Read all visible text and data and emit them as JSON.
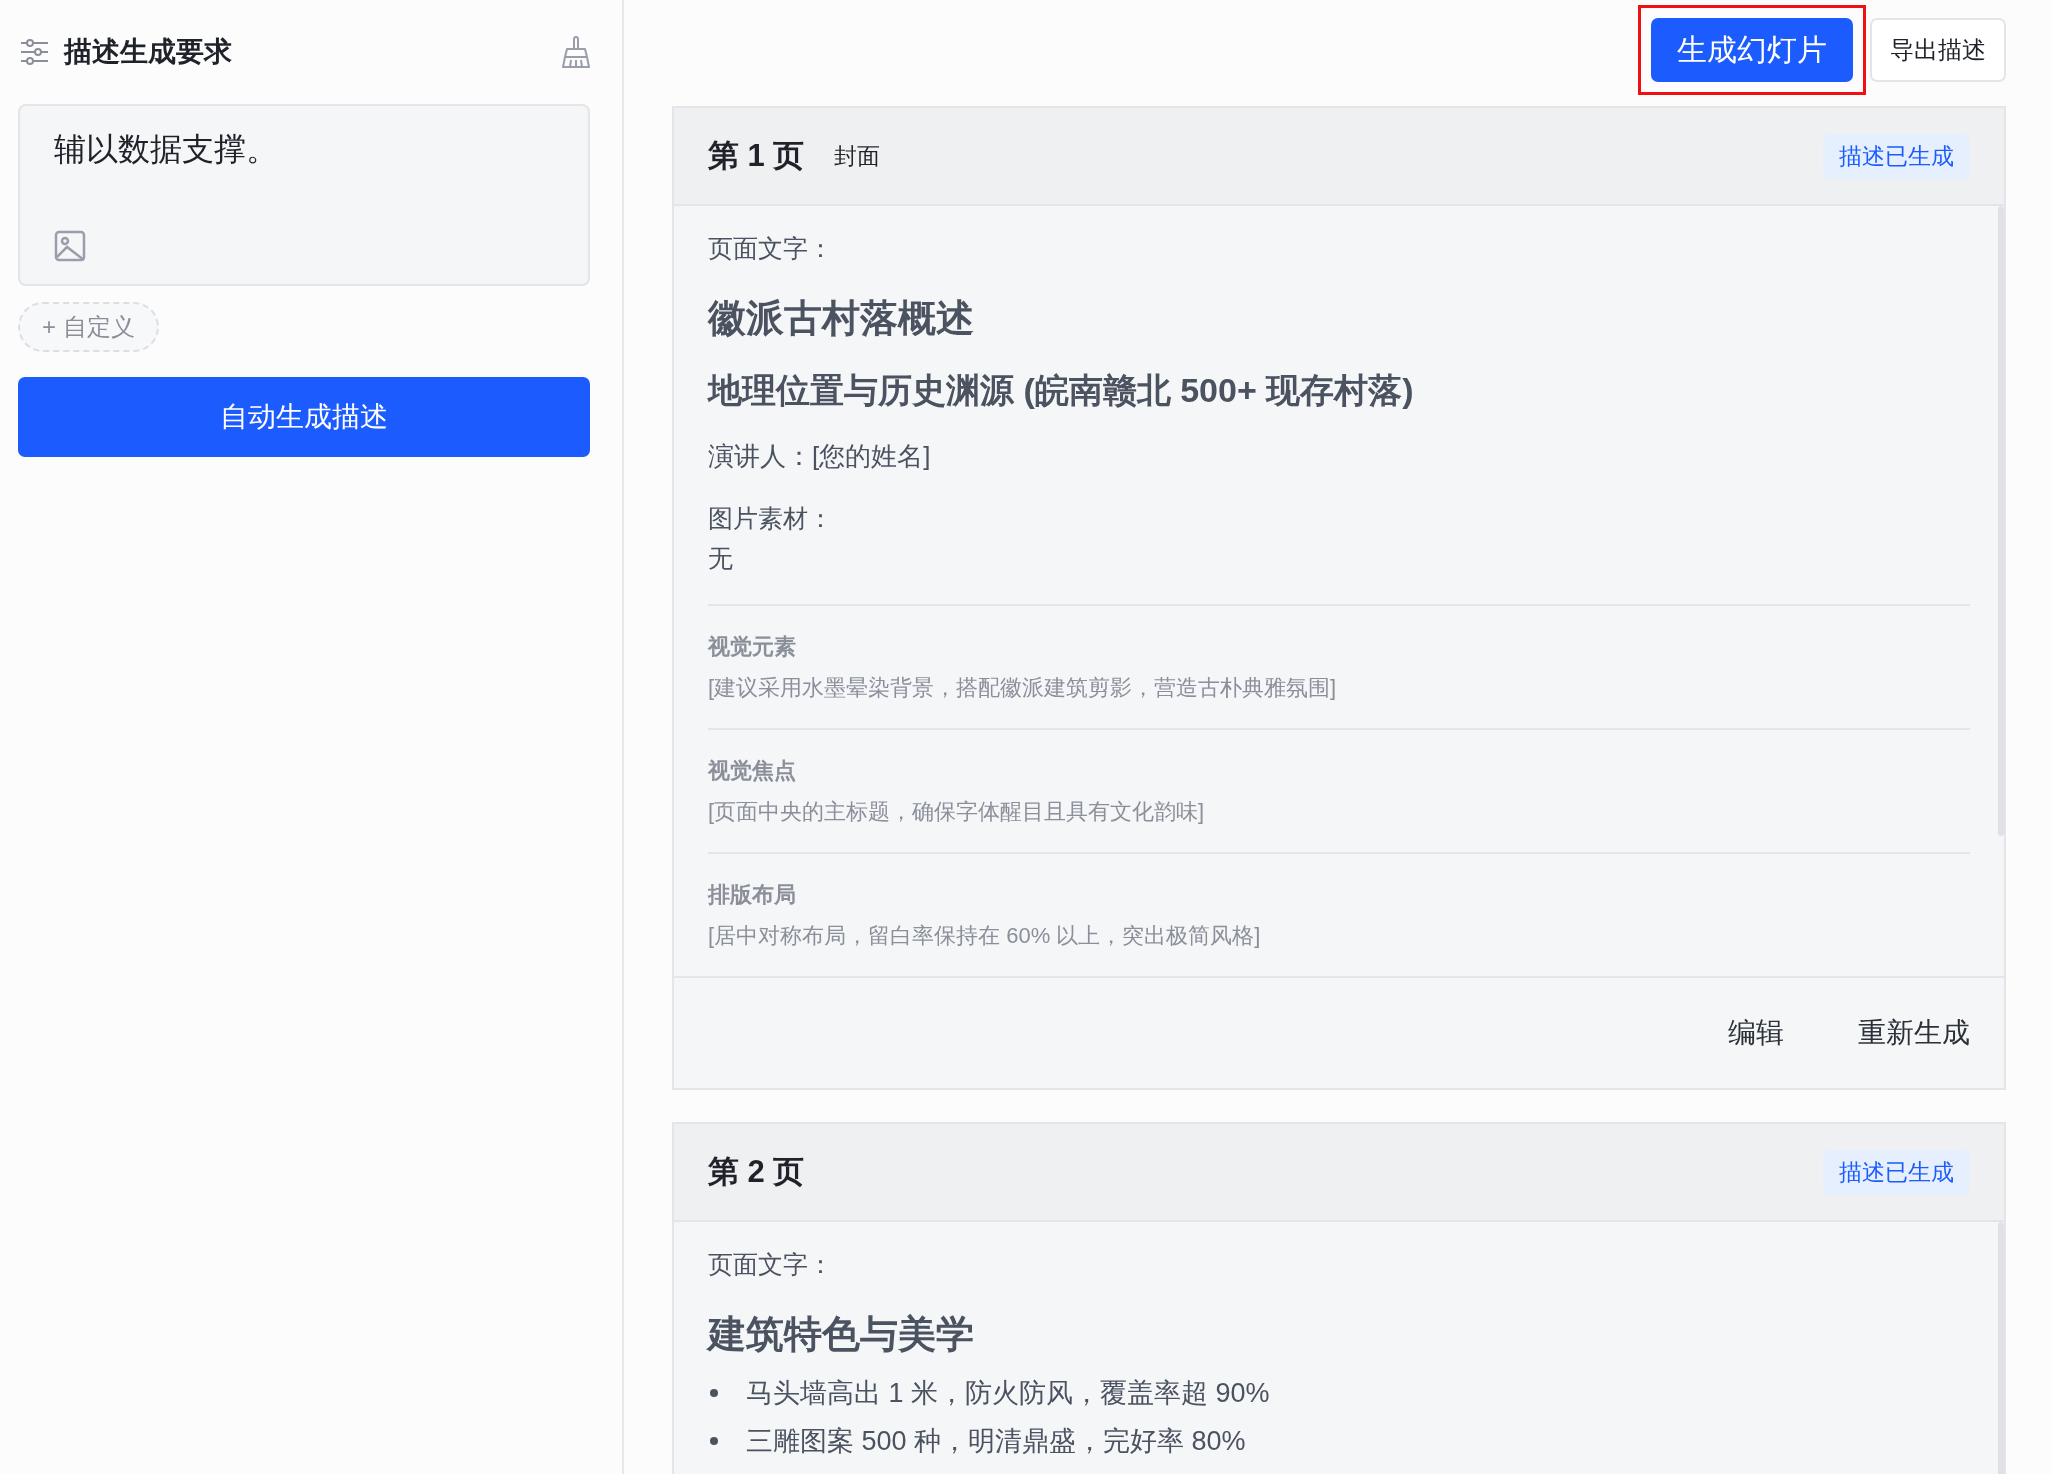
{
  "sidebar": {
    "title": "描述生成要求",
    "prompt": {
      "value": "辅以数据支撑。"
    },
    "custom_chip": "+ 自定义",
    "generate_button": "自动生成描述"
  },
  "toolbar": {
    "buttons": [
      {
        "label": "生成幻灯片",
        "kind": "primary",
        "highlighted": true
      },
      {
        "label": "导出描述",
        "kind": "secondary",
        "highlighted": false
      }
    ]
  },
  "pages": [
    {
      "number": "第 1 页",
      "subtitle": "封面",
      "status": "描述已生成",
      "text_label": "页面文字：",
      "blocks": [
        {
          "kind": "h1",
          "text": "徽派古村落概述"
        },
        {
          "kind": "h2",
          "text": "地理位置与历史渊源 (皖南赣北 500+ 现存村落)"
        },
        {
          "kind": "p",
          "text": "演讲人：[您的姓名]"
        }
      ],
      "image_label": "图片素材：",
      "image_value": "无",
      "sections": [
        {
          "label": "视觉元素",
          "text": "[建议采用水墨晕染背景，搭配徽派建筑剪影，营造古朴典雅氛围]"
        },
        {
          "label": "视觉焦点",
          "text": "[页面中央的主标题，确保字体醒目且具有文化韵味]"
        },
        {
          "label": "排版布局",
          "text": "[居中对称布局，留白率保持在 60% 以上，突出极简风格]"
        }
      ],
      "actions": [
        "编辑",
        "重新生成"
      ]
    },
    {
      "number": "第 2 页",
      "status": "描述已生成",
      "text_label": "页面文字：",
      "blocks": [
        {
          "kind": "h1",
          "text": "建筑特色与美学"
        },
        {
          "kind": "bullet",
          "text": "马头墙高出 1 米，防火防风，覆盖率超 90%"
        },
        {
          "kind": "bullet",
          "text": "三雕图案 500 种，明清鼎盛，完好率 80%"
        }
      ]
    }
  ]
}
